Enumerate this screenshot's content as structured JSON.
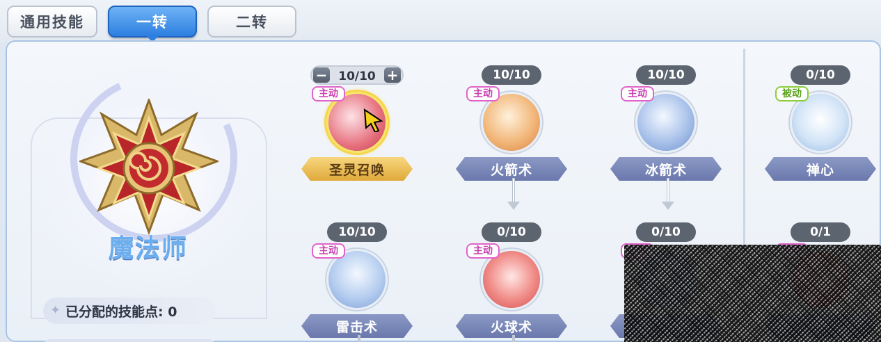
{
  "tabs": [
    {
      "label": "通用技能",
      "active": false
    },
    {
      "label": "一转",
      "active": true
    },
    {
      "label": "二转",
      "active": false
    }
  ],
  "class_name": "魔法师",
  "points_label": "已分配的技能点: 0",
  "controls": {
    "minus": "−",
    "plus": "+"
  },
  "colors": {
    "active_tab": "#2c7ee0",
    "gold_label": "#e0a93a",
    "skill_label": "#6a78ac",
    "tag_active": "#e163c9",
    "tag_passive": "#8ccd3a"
  },
  "skills": {
    "row1": [
      {
        "level": "10/10",
        "tag": "主动",
        "name": "圣灵召唤",
        "icon": "holy-orb-icon",
        "selected": true
      },
      {
        "level": "10/10",
        "tag": "主动",
        "name": "火箭术",
        "icon": "fire-arrow-icon"
      },
      {
        "level": "10/10",
        "tag": "主动",
        "name": "冰箭术",
        "icon": "ice-arrow-icon"
      },
      {
        "level": "0/10",
        "tag": "被动",
        "name": "禅心",
        "icon": "meditation-icon"
      }
    ],
    "row2": [
      {
        "level": "10/10",
        "tag": "主动",
        "name": "雷击术",
        "icon": "lightning-icon"
      },
      {
        "level": "0/10",
        "tag": "主动",
        "name": "火球术",
        "icon": "fireball-icon"
      },
      {
        "level": "0/10",
        "tag": "主动",
        "name": "",
        "icon": "obscured-skill-icon"
      },
      {
        "level": "0/1",
        "tag": "主动",
        "name": "",
        "icon": "obscured-skill-icon"
      }
    ]
  }
}
